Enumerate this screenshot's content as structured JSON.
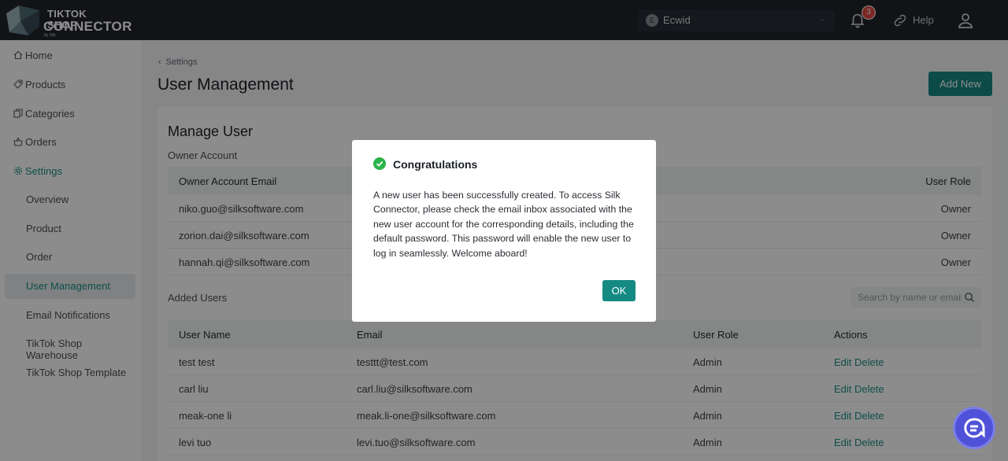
{
  "header": {
    "logo_line1": "TIKTOK SHOP",
    "logo_line2": "CONNECTOR",
    "logo_line3": "by Silk",
    "store": {
      "initial": "E",
      "name": "Ecwid"
    },
    "notifications_count": "3",
    "help_label": "Help"
  },
  "sidebar": {
    "items": [
      {
        "label": "Home",
        "icon": "home-icon"
      },
      {
        "label": "Products",
        "icon": "tag-icon"
      },
      {
        "label": "Categories",
        "icon": "copy-icon"
      },
      {
        "label": "Orders",
        "icon": "basket-icon"
      },
      {
        "label": "Settings",
        "icon": "gear-icon"
      }
    ],
    "sub_items": [
      {
        "label": "Overview"
      },
      {
        "label": "Product"
      },
      {
        "label": "Order"
      },
      {
        "label": "User Management"
      },
      {
        "label": "Email Notifications"
      },
      {
        "label": "TikTok Shop Warehouse"
      },
      {
        "label": "TikTok Shop Template"
      }
    ]
  },
  "main": {
    "breadcrumb": "Settings",
    "title": "User Management",
    "add_new_label": "Add New",
    "card_title": "Manage User",
    "owner_section_label": "Owner Account",
    "owner_table": {
      "headers": [
        "Owner Account Email",
        "User Role"
      ],
      "rows": [
        {
          "email": "niko.guo@silksoftware.com",
          "role": "Owner"
        },
        {
          "email": "zorion.dai@silksoftware.com",
          "role": "Owner"
        },
        {
          "email": "hannah.qi@silksoftware.com",
          "role": "Owner"
        }
      ]
    },
    "added_section_label": "Added Users",
    "search_placeholder": "Search by name or email",
    "users_table": {
      "headers": [
        "User Name",
        "Email",
        "User Role",
        "Actions"
      ],
      "edit_label": "Edit",
      "delete_label": "Delete",
      "rows": [
        {
          "name": "test test",
          "email": "testtt@test.com",
          "role": "Admin"
        },
        {
          "name": "carl liu",
          "email": "carl.liu@silksoftware.com",
          "role": "Admin"
        },
        {
          "name": "meak-one li",
          "email": "meak.li-one@silksoftware.com",
          "role": "Admin"
        },
        {
          "name": "levi tuo",
          "email": "levi.tuo@silksoftware.com",
          "role": "Admin"
        }
      ]
    }
  },
  "modal": {
    "title": "Congratulations",
    "body": "A new user has been successfully created. To access Silk Connector, please check the email inbox associated with the new user account for the corresponding details, including the default password. This password will enable the new user to log in seamlessly. Welcome aboard!",
    "ok_label": "OK"
  },
  "colors": {
    "accent": "#158a83",
    "header_bg": "#1f2329",
    "badge": "#e14a42",
    "chat_fab": "#4f52d8"
  }
}
